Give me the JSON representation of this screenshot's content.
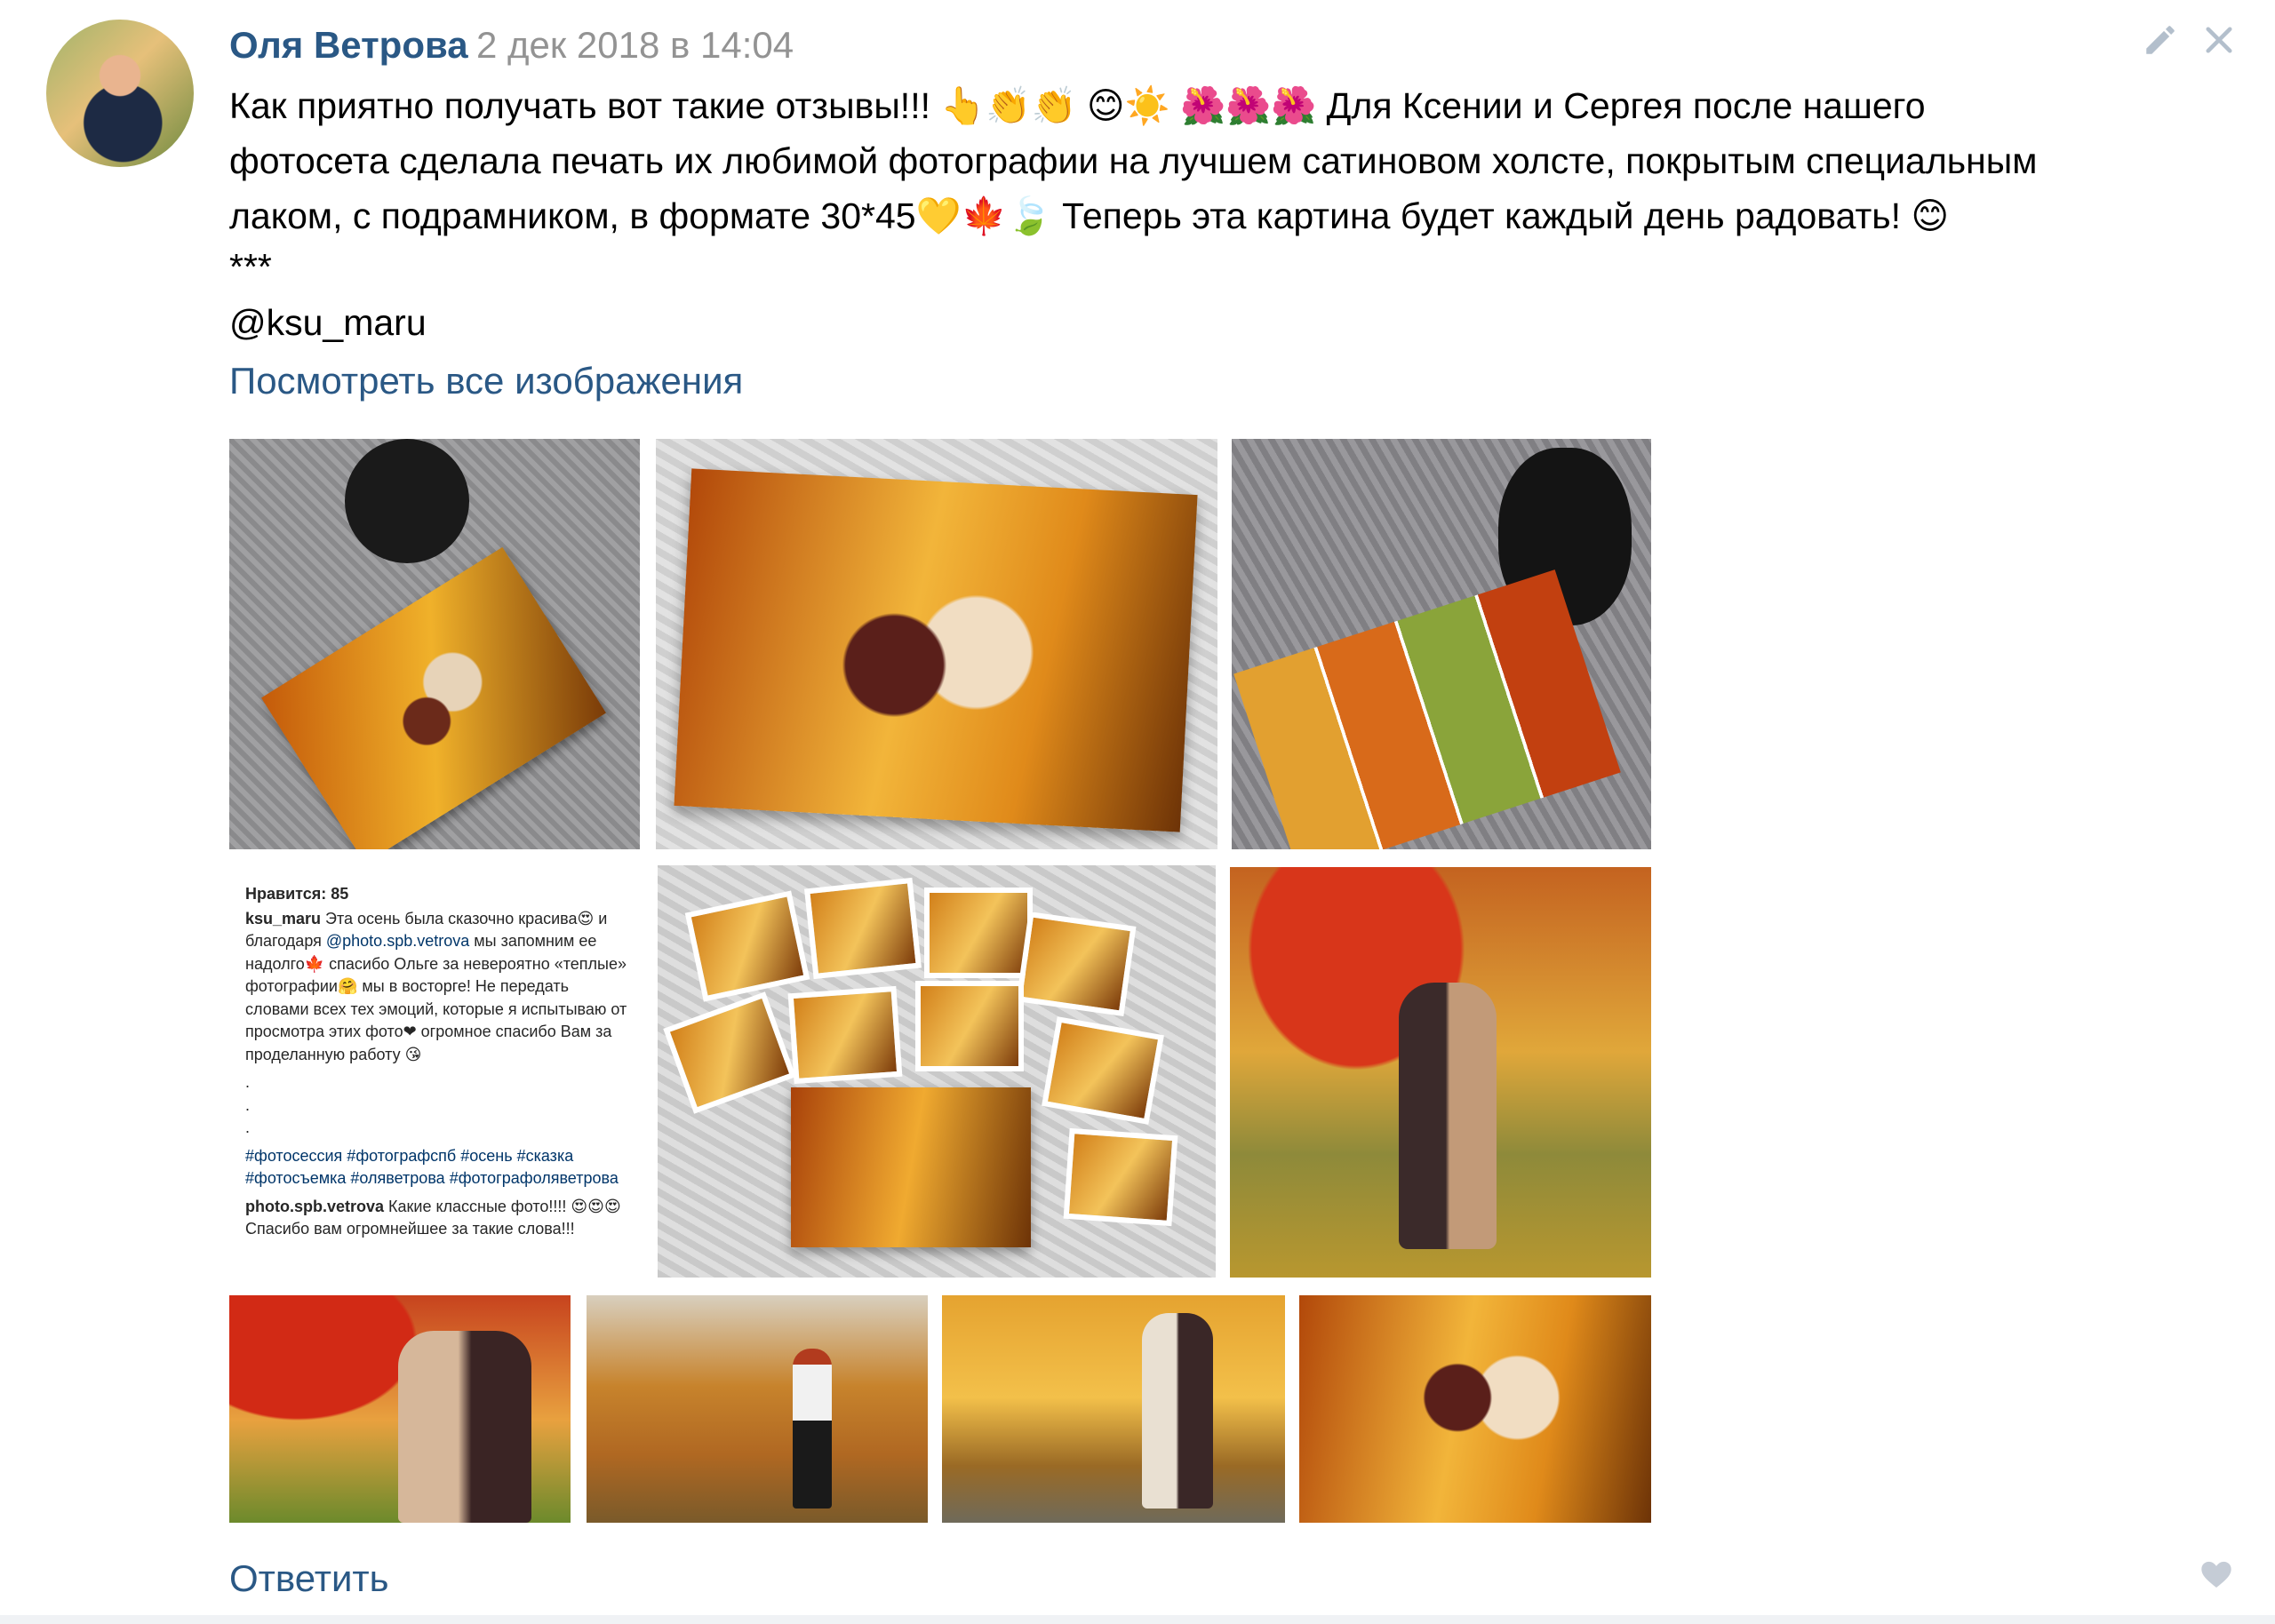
{
  "post": {
    "author": "Оля Ветрова",
    "date": "2 дек 2018 в 14:04",
    "text_lines": [
      "Как приятно получать вот такие отзывы!!! 👆👏👏 😊☀️ 🌺🌺🌺 Для Ксении и Сергея после нашего",
      "фотосета сделала печать их любимой фотографии на лучшем сатиновом холсте, покрытым специальным",
      "лаком, с подрамником, в формате 30*45💛🍁🍃 Теперь эта картина будет каждый день радовать! 😊",
      "***",
      "@ksu_maru"
    ],
    "view_all_link": "Посмотреть все изображения",
    "reply_link": "Ответить"
  },
  "instagram_comment": {
    "likes": "Нравится: 85",
    "user": "ksu_maru",
    "text_1": " Эта осень была сказочно красива😍 и благодаря ",
    "mention": "@photo.spb.vetrova",
    "text_2": " мы запомним ее надолго🍁 спасибо Ольге за невероятно «теплые» фотографии🤗 мы в восторге! Не передать словами всех тех эмоций, которые я испытываю от просмотра этих фото❤ огромное спасибо Вам за проделанную работу 😘",
    "dots": ".\n.\n.",
    "hashtags": "#фотосессия #фотографспб #осень #сказка #фотосъемка #оляветрова #фотографоляветрова",
    "reply_user": "photo.spb.vetrova",
    "reply_text": " Какие классные фото!!!! 😍😍😍 Спасибо вам огромнейшее за такие слова!!!"
  },
  "icons": {
    "edit": "pencil-icon",
    "close": "close-icon",
    "like": "heart-icon"
  },
  "colors": {
    "link": "#2a5885",
    "meta": "#939393",
    "icon": "#b3bfcc"
  }
}
